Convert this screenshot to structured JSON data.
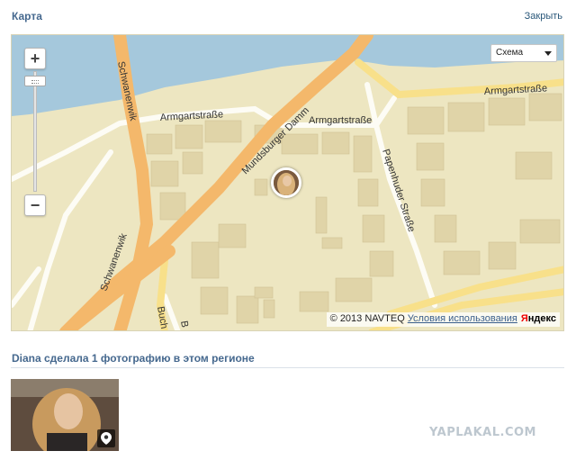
{
  "header": {
    "title": "Карта",
    "close_label": "Закрыть"
  },
  "map": {
    "layer_select_value": "Схема",
    "zoom_in_label": "+",
    "zoom_out_label": "−",
    "street_labels": {
      "armgart_top": "Armgartstraße",
      "armgart_left": "Armgartstraße",
      "armgart_mid": "Armgartstraße",
      "mundsburger": "Mundsburger Damm",
      "schwanenwik_top": "Schwanenwik",
      "schwanenwik_bottom": "Schwanenwik",
      "papenhuder": "Papenhuder Straße",
      "buch": "Buch",
      "b": "B"
    },
    "copyright_text": "© 2013 NAVTEQ",
    "terms_label": "Условия использования",
    "logo_first": "Я",
    "logo_rest": "ндекс",
    "colors": {
      "land": "#ede6c1",
      "water": "#a5c8dc",
      "major_road": "#f4b86b",
      "minor_road": "#fdfcf5",
      "building": "#e0d4a8",
      "yellow_road": "#f8e08a"
    }
  },
  "photos_section": {
    "title": "Diana сделала 1 фотографию в этом регионе"
  },
  "watermark": "YAPLAKAL.COM"
}
